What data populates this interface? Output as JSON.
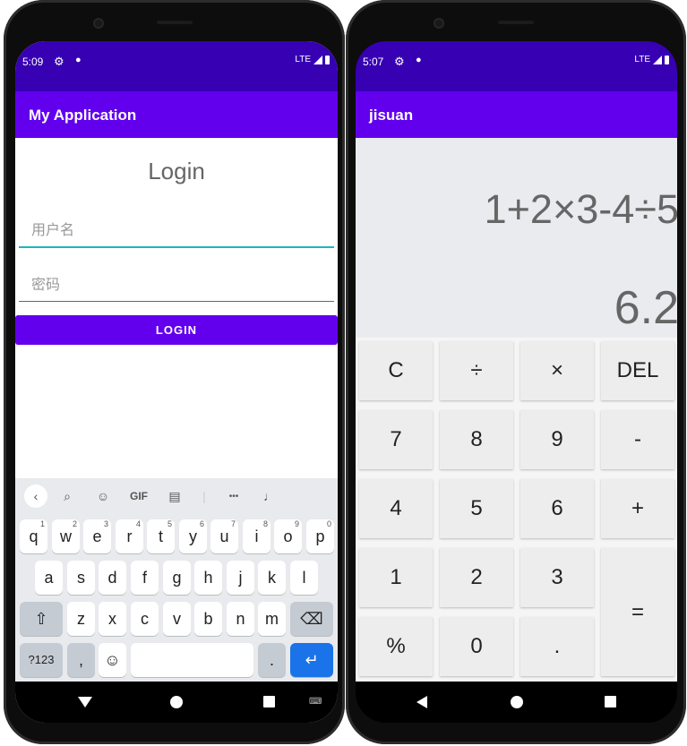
{
  "left_phone": {
    "status": {
      "time": "5:09",
      "network": "LTE"
    },
    "app_title": "My Application",
    "login": {
      "title": "Login",
      "username_placeholder": "用户名",
      "password_placeholder": "密码",
      "button_label": "LOGIN"
    },
    "keyboard": {
      "toolbar": {
        "gif_label": "GIF",
        "more_label": "•••"
      },
      "row1": [
        {
          "key": "q",
          "num": "1"
        },
        {
          "key": "w",
          "num": "2"
        },
        {
          "key": "e",
          "num": "3"
        },
        {
          "key": "r",
          "num": "4"
        },
        {
          "key": "t",
          "num": "5"
        },
        {
          "key": "y",
          "num": "6"
        },
        {
          "key": "u",
          "num": "7"
        },
        {
          "key": "i",
          "num": "8"
        },
        {
          "key": "o",
          "num": "9"
        },
        {
          "key": "p",
          "num": "0"
        }
      ],
      "row2": [
        "a",
        "s",
        "d",
        "f",
        "g",
        "h",
        "j",
        "k",
        "l"
      ],
      "row3": [
        "z",
        "x",
        "c",
        "v",
        "b",
        "n",
        "m"
      ],
      "bottom": {
        "symbols": "?123",
        "comma": ",",
        "period": "."
      }
    }
  },
  "right_phone": {
    "status": {
      "time": "5:07",
      "network": "LTE"
    },
    "app_title": "jisuan",
    "expression": "1+2×3-4÷5",
    "result": "6.2",
    "keys": {
      "clear": "C",
      "divide": "÷",
      "multiply": "×",
      "delete": "DEL",
      "seven": "7",
      "eight": "8",
      "nine": "9",
      "minus": "-",
      "four": "4",
      "five": "5",
      "six": "6",
      "plus": "+",
      "one": "1",
      "two": "2",
      "three": "3",
      "equals": "=",
      "percent": "%",
      "zero": "0",
      "dot": "."
    }
  }
}
